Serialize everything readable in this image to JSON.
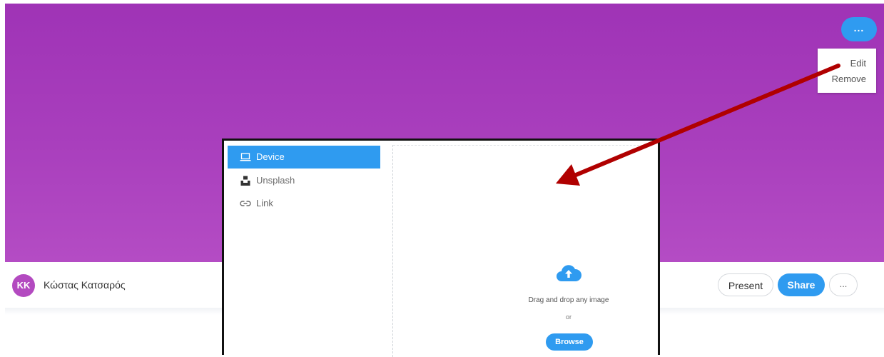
{
  "banner": {
    "menu_button_label": "...",
    "menu_items": [
      "Edit",
      "Remove"
    ]
  },
  "header": {
    "avatar_initials": "KK",
    "username": "Κώστας Κατσαρός",
    "present_label": "Present",
    "share_label": "Share",
    "more_label": "..."
  },
  "dialog": {
    "sources": [
      {
        "label": "Device",
        "icon": "laptop-icon",
        "active": true
      },
      {
        "label": "Unsplash",
        "icon": "unsplash-icon",
        "active": false
      },
      {
        "label": "Link",
        "icon": "link-icon",
        "active": false
      }
    ],
    "drop_text": "Drag and drop any image",
    "or_text": "or",
    "browse_label": "Browse"
  },
  "colors": {
    "banner": "#a63bbb",
    "accent": "#2f9bf0",
    "arrow": "#b00000",
    "avatar": "#b34ac0"
  }
}
